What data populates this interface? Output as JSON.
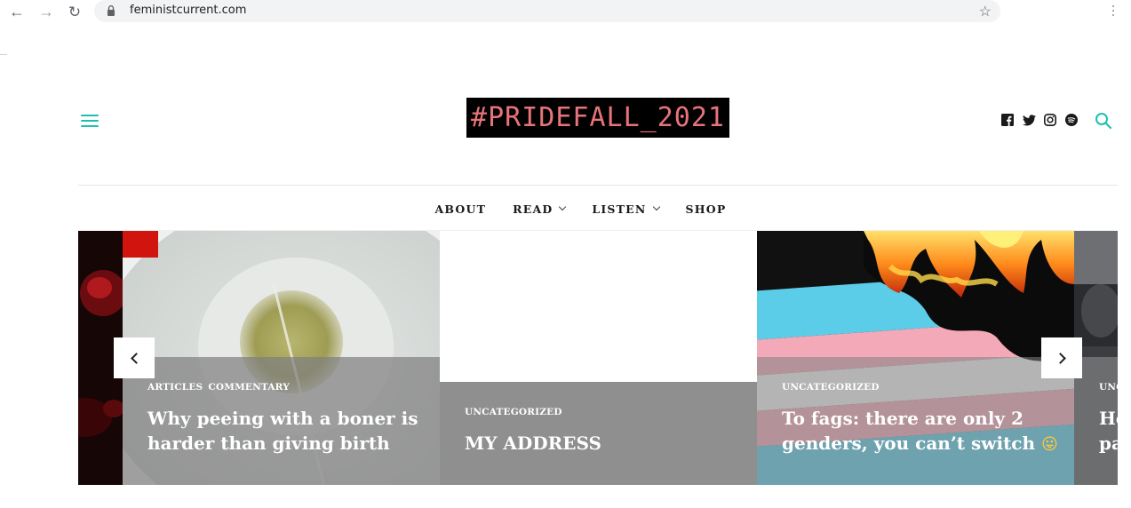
{
  "browser": {
    "url": "feministcurrent.com",
    "back_icon": "←",
    "forward_icon": "→",
    "reload_icon": "↻",
    "star_icon": "☆"
  },
  "header": {
    "logo_text": "#PRIDEFALL_2021",
    "accent_color": "#1fbfae",
    "logo_text_color": "#e8747a"
  },
  "social": [
    "facebook-icon",
    "twitter-icon",
    "instagram-icon",
    "spotify-icon"
  ],
  "menu": {
    "items": [
      {
        "label": "ABOUT",
        "has_dropdown": false
      },
      {
        "label": "READ",
        "has_dropdown": true
      },
      {
        "label": "LISTEN",
        "has_dropdown": true
      },
      {
        "label": "SHOP",
        "has_dropdown": false
      }
    ]
  },
  "slider": {
    "slides": [
      {
        "categories": [
          "ARTICLES",
          "COMMENTARY"
        ],
        "title_line1": "Why peeing with a boner is",
        "title_line2": "harder than giving birth"
      },
      {
        "categories": [
          "UNCATEGORIZED"
        ],
        "title_line1": "MY ADDRESS"
      },
      {
        "categories": [
          "UNCATEGORIZED"
        ],
        "title_line1": "To fags: there are only 2",
        "title_line2": "genders, you can’t switch",
        "emoji": "😛"
      },
      {
        "categories_partial": "UNC",
        "title_partial_1": "He",
        "title_partial_2": "pa"
      }
    ]
  }
}
